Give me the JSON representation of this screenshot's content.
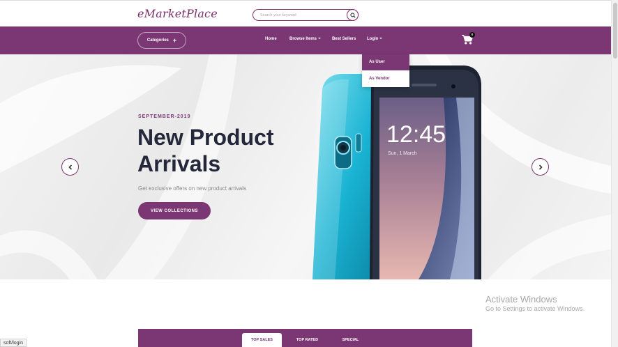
{
  "header": {
    "logo": "eMarketPlace",
    "search_placeholder": "Search your keyword"
  },
  "nav": {
    "categories_label": "Categories",
    "links": [
      {
        "label": "Home",
        "has_caret": false
      },
      {
        "label": "Browse Items",
        "has_caret": true
      },
      {
        "label": "Best Sellers",
        "has_caret": false
      },
      {
        "label": "Login",
        "has_caret": true
      }
    ],
    "cart_count": "0"
  },
  "login_dropdown": {
    "items": [
      {
        "label": "As User",
        "active": true
      },
      {
        "label": "As Vendor",
        "active": false
      }
    ]
  },
  "hero": {
    "eyebrow": "SEPTEMBER-2019",
    "title": "New Product Arrivals",
    "subtitle": "Get exclusive offers on new product arrivals",
    "cta": "VIEW COLLECTIONS",
    "phone_time": "12:45",
    "phone_date": "Sun, 1 March"
  },
  "product_tabs": [
    {
      "label": "TOP SALES",
      "active": true
    },
    {
      "label": "TOP RATED",
      "active": false
    },
    {
      "label": "SPECIAL",
      "active": false
    }
  ],
  "watermark": {
    "title": "Activate Windows",
    "subtitle": "Go to Settings to activate Windows."
  },
  "status_bar": {
    "url": "soft/login"
  },
  "colors": {
    "brand": "#7b3773",
    "text_dark": "#24283a"
  },
  "icons": [
    "search-icon",
    "plus-icon",
    "caret-down-icon",
    "cart-icon",
    "chevron-left-icon",
    "chevron-right-icon"
  ]
}
